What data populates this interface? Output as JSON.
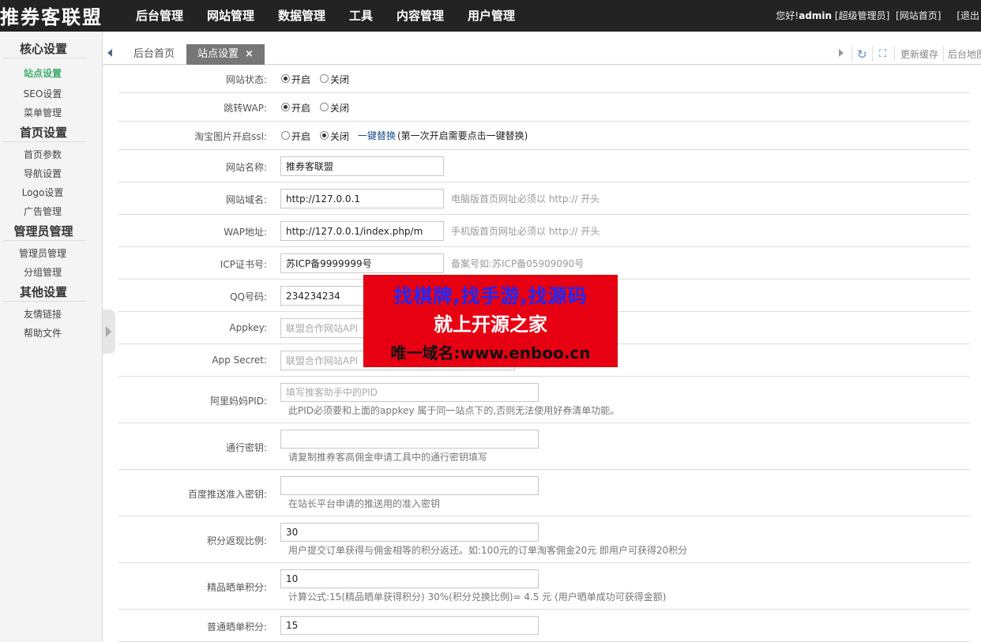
{
  "header": {
    "logo": "推券客联盟",
    "nav": [
      "后台管理",
      "网站管理",
      "数据管理",
      "工具",
      "内容管理",
      "用户管理"
    ],
    "greeting": "您好!",
    "username": "admin",
    "role": "[超级管理员]",
    "site_home": "[网站首页]",
    "logout": "[退出"
  },
  "sidebar": {
    "groups": [
      {
        "title": "核心设置",
        "items": [
          "站点设置",
          "SEO设置",
          "菜单管理"
        ]
      },
      {
        "title": "首页设置",
        "items": [
          "首页参数",
          "导航设置",
          "Logo设置",
          "广告管理"
        ]
      },
      {
        "title": "管理员管理",
        "items": [
          "管理员管理",
          "分组管理"
        ]
      },
      {
        "title": "其他设置",
        "items": [
          "友情链接",
          "帮助文件"
        ]
      }
    ],
    "active": "站点设置"
  },
  "tabs": {
    "home": "后台首页",
    "current": "站点设置",
    "close": "×",
    "update_cache": "更新缓存",
    "sitemap": "后台地图"
  },
  "icons": {
    "refresh": "refresh-icon",
    "fullscreen": "fullscreen-icon",
    "prev": "chevron-left-icon",
    "next": "chevron-right-icon"
  },
  "form": {
    "site_status": {
      "label": "网站状态:",
      "on": "开启",
      "off": "关闭",
      "selected": "开启"
    },
    "jump_wap": {
      "label": "跳转WAP:",
      "on": "开启",
      "off": "关闭",
      "selected": "开启"
    },
    "taobao_ssl": {
      "label": "淘宝图片开启ssl:",
      "on": "开启",
      "off": "关闭",
      "selected": "关闭",
      "link": "一键替换",
      "note": "(第一次开启需要点击一键替换)"
    },
    "site_name": {
      "label": "网站名称:",
      "value": "推券客联盟"
    },
    "site_domain": {
      "label": "网站域名:",
      "value": "http://127.0.0.1",
      "hint": "电脑版首页网址必须以 http:// 开头"
    },
    "wap_url": {
      "label": "WAP地址:",
      "value": "http://127.0.0.1/index.php/m",
      "hint": "手机版首页网址必须以 http:// 开头"
    },
    "icp": {
      "label": "ICP证书号:",
      "value": "苏ICP备9999999号",
      "hint": "备案号如:苏ICP备05909090号"
    },
    "qq": {
      "label": "QQ号码:",
      "value": "234234234"
    },
    "appkey": {
      "label": "Appkey:",
      "placeholder": "联盟合作网站API"
    },
    "app_secret": {
      "label": "App Secret:",
      "placeholder": "联盟合作网站API"
    },
    "alimama_pid": {
      "label": "阿里妈妈PID:",
      "placeholder": "填写推客助手中的PID",
      "hint": "此PID必须要和上面的appkey 属于同一站点下的,否则无法使用好券清单功能。"
    },
    "pass_key": {
      "label": "通行密钥:",
      "value": "",
      "hint": "请复制推券客高佣金申请工具中的通行密钥填写"
    },
    "baidu_key": {
      "label": "百度推送准入密钥:",
      "value": "",
      "hint": "在站长平台申请的推送用的准入密钥"
    },
    "cashback_ratio": {
      "label": "积分返现比例:",
      "value": "30",
      "hint": "用户提交订单获得与佣金相等的积分返还。如:100元的订单淘客佣金20元 即用户可获得20积分"
    },
    "premium_share": {
      "label": "精品晒单积分:",
      "value": "10",
      "hint": "计算公式:15(精品晒单获得积分) 30%(积分兑换比例)= 4.5 元 (用户晒单成功可获得金额)"
    },
    "normal_share": {
      "label": "普通晒单积分:",
      "value": "15"
    }
  },
  "ad_overlay": {
    "line1": "找棋牌,找手游,找源码",
    "line2": "就上开源之家",
    "line3": "唯一域名:www.enboo.cn"
  },
  "colors": {
    "topbar": "#232323",
    "active_menu": "#3fae6a",
    "ad_bg": "#e60012",
    "ad_blue": "#1b29ff"
  }
}
